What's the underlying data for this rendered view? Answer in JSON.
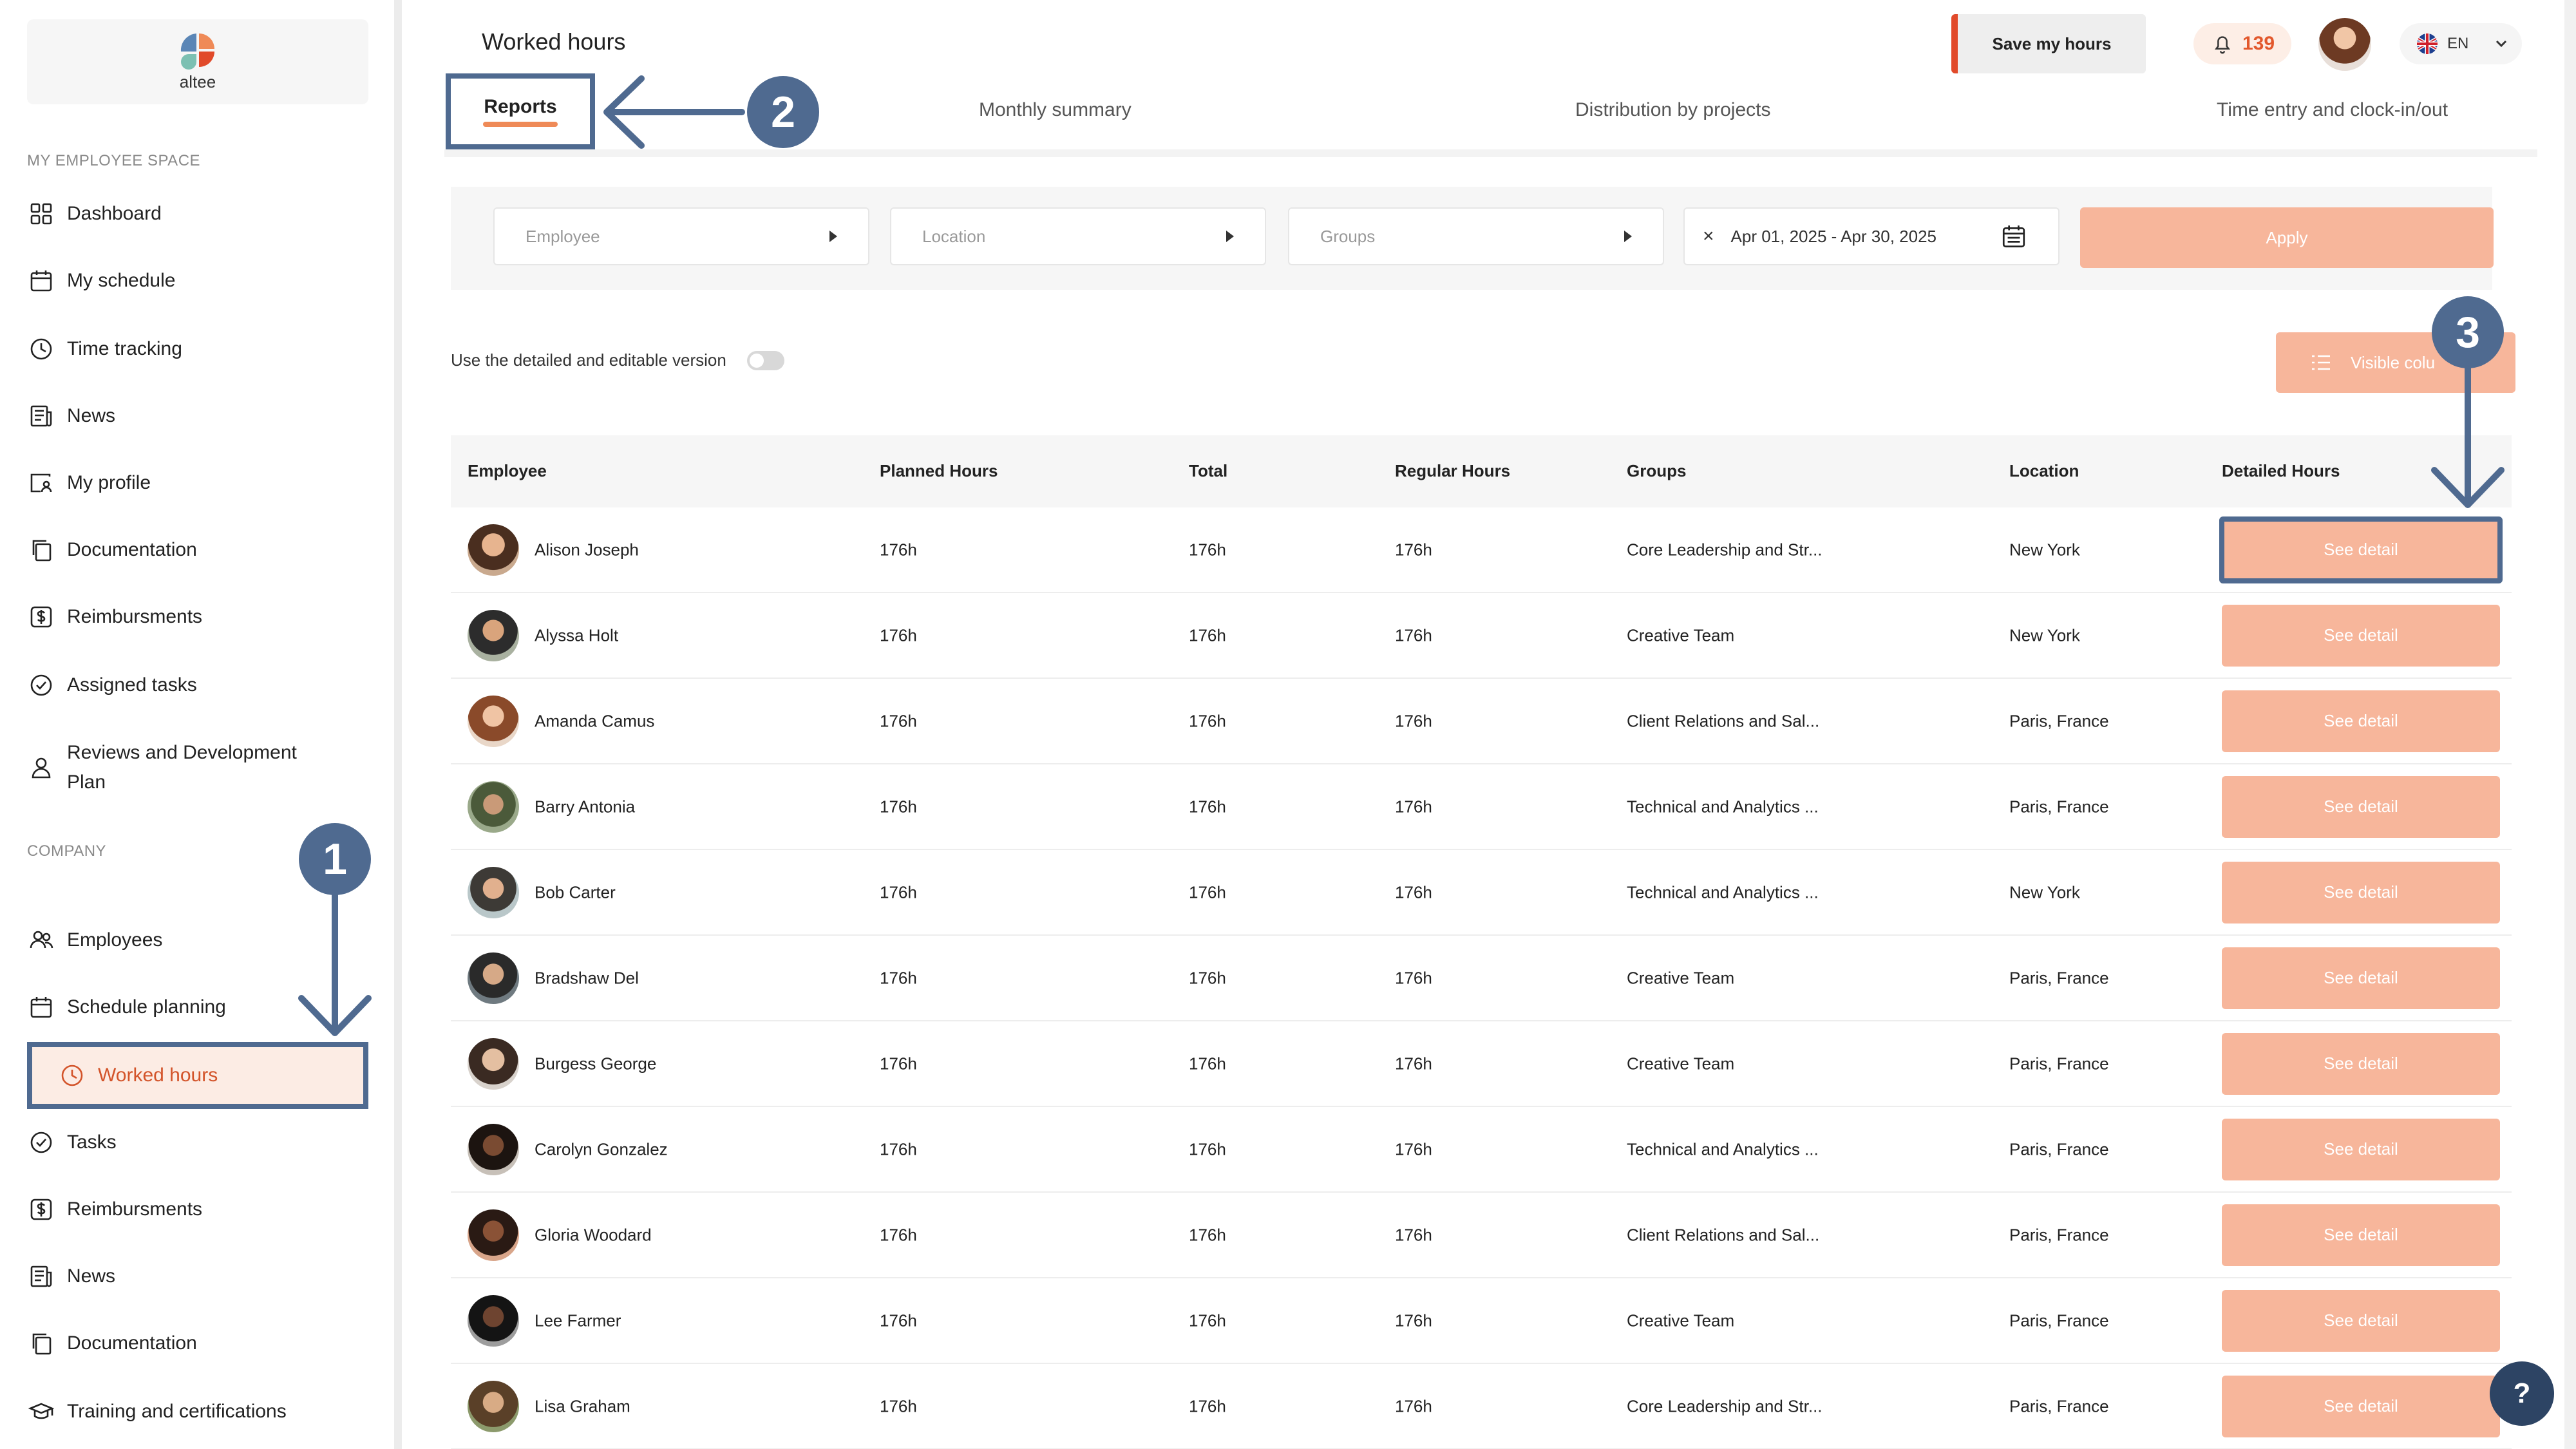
{
  "app": {
    "logo_text": "altee",
    "page_title": "Worked hours"
  },
  "header": {
    "save_label": "Save my hours",
    "notifications_count": "139",
    "language": "EN"
  },
  "sidebar": {
    "section_employee": "MY EMPLOYEE SPACE",
    "employee_items": [
      {
        "label": "Dashboard",
        "icon": "grid-icon"
      },
      {
        "label": "My schedule",
        "icon": "calendar-icon"
      },
      {
        "label": "Time tracking",
        "icon": "clock-icon"
      },
      {
        "label": "News",
        "icon": "newspaper-icon"
      },
      {
        "label": "My profile",
        "icon": "profile-icon"
      },
      {
        "label": "Documentation",
        "icon": "documents-icon"
      },
      {
        "label": "Reimbursments",
        "icon": "dollar-icon"
      },
      {
        "label": "Assigned tasks",
        "icon": "check-circle-icon"
      },
      {
        "label": "Reviews and Development Plan",
        "icon": "person-icon"
      }
    ],
    "section_company": "COMPANY",
    "company_items": [
      {
        "label": "Employees",
        "icon": "users-icon"
      },
      {
        "label": "Schedule planning",
        "icon": "calendar-icon"
      },
      {
        "label": "Worked hours",
        "icon": "clock-icon",
        "active": true
      },
      {
        "label": "Tasks",
        "icon": "check-circle-icon"
      },
      {
        "label": "Reimbursments",
        "icon": "dollar-icon"
      },
      {
        "label": "News",
        "icon": "newspaper-icon"
      },
      {
        "label": "Documentation",
        "icon": "documents-icon"
      },
      {
        "label": "Training and certifications",
        "icon": "graduation-cap-icon"
      }
    ]
  },
  "tabs": [
    {
      "label": "Reports",
      "active": true
    },
    {
      "label": "Monthly summary"
    },
    {
      "label": "Distribution by projects"
    },
    {
      "label": "Time entry and clock-in/out"
    }
  ],
  "filters": {
    "employee_placeholder": "Employee",
    "location_placeholder": "Location",
    "groups_placeholder": "Groups",
    "date_range": "Apr 01, 2025 - Apr 30, 2025",
    "clear_symbol": "×",
    "apply_label": "Apply"
  },
  "options": {
    "toggle_label": "Use the detailed and editable version",
    "visible_columns_label": "Visible colu"
  },
  "table": {
    "columns": [
      "Employee",
      "Planned Hours",
      "Total",
      "Regular Hours",
      "Groups",
      "Location",
      "Detailed Hours"
    ],
    "button_label": "See detail",
    "rows": [
      {
        "name": "Alison Joseph",
        "planned": "176h",
        "total": "176h",
        "regular": "176h",
        "groups": "Core Leadership and Str...",
        "location": "New York"
      },
      {
        "name": "Alyssa Holt",
        "planned": "176h",
        "total": "176h",
        "regular": "176h",
        "groups": "Creative Team",
        "location": "New York"
      },
      {
        "name": "Amanda Camus",
        "planned": "176h",
        "total": "176h",
        "regular": "176h",
        "groups": "Client Relations and Sal...",
        "location": "Paris, France"
      },
      {
        "name": "Barry Antonia",
        "planned": "176h",
        "total": "176h",
        "regular": "176h",
        "groups": "Technical and Analytics ...",
        "location": "Paris, France"
      },
      {
        "name": "Bob Carter",
        "planned": "176h",
        "total": "176h",
        "regular": "176h",
        "groups": "Technical and Analytics ...",
        "location": "New York"
      },
      {
        "name": "Bradshaw Del",
        "planned": "176h",
        "total": "176h",
        "regular": "176h",
        "groups": "Creative Team",
        "location": "Paris, France"
      },
      {
        "name": "Burgess George",
        "planned": "176h",
        "total": "176h",
        "regular": "176h",
        "groups": "Creative Team",
        "location": "Paris, France"
      },
      {
        "name": "Carolyn Gonzalez",
        "planned": "176h",
        "total": "176h",
        "regular": "176h",
        "groups": "Technical and Analytics ...",
        "location": "Paris, France"
      },
      {
        "name": "Gloria Woodard",
        "planned": "176h",
        "total": "176h",
        "regular": "176h",
        "groups": "Client Relations and Sal...",
        "location": "Paris, France"
      },
      {
        "name": "Lee Farmer",
        "planned": "176h",
        "total": "176h",
        "regular": "176h",
        "groups": "Creative Team",
        "location": "Paris, France"
      },
      {
        "name": "Lisa Graham",
        "planned": "176h",
        "total": "176h",
        "regular": "176h",
        "groups": "Core Leadership and Str...",
        "location": "Paris, France"
      }
    ]
  },
  "annotations": {
    "step1": "1",
    "step2": "2",
    "step3": "3",
    "color": "#4f6a90"
  },
  "help_label": "?",
  "colors": {
    "accent": "#ef8a57",
    "button": "#f7b69b",
    "active_text": "#d3542a",
    "annotation": "#4f6a90"
  }
}
